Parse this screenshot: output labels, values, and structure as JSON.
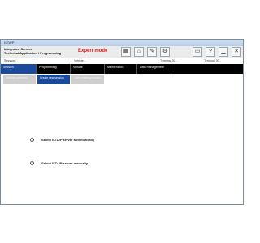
{
  "window": {
    "title": "ISTA/P"
  },
  "header": {
    "app_title_line1": "Integrated Service",
    "app_title_line2": "Technical Application / Programming",
    "mode": "Expert mode"
  },
  "toolbar": {
    "buttons": [
      {
        "name": "grid-icon",
        "glyph": "▦"
      },
      {
        "name": "home-icon",
        "glyph": "⌂"
      },
      {
        "name": "wrench-icon",
        "glyph": "✎"
      },
      {
        "name": "plugin-icon",
        "glyph": "⚙"
      },
      {
        "name": "window-icon",
        "glyph": "▭"
      },
      {
        "name": "help-icon",
        "glyph": "?"
      },
      {
        "name": "minimize-icon",
        "glyph": "▁"
      },
      {
        "name": "close-icon",
        "glyph": "✕"
      }
    ]
  },
  "selectors": {
    "session": "Session -",
    "vehicle": "Vehicle -",
    "terminal_30": "Terminal 30 -",
    "terminal_15": "Terminal 30 -"
  },
  "nav": {
    "tabs": [
      {
        "label": "Session",
        "active": true
      },
      {
        "label": "Programming",
        "active": false
      },
      {
        "label": "Vehicle",
        "active": false
      },
      {
        "label": "Maintenance",
        "active": false
      },
      {
        "label": "Data management",
        "active": false
      }
    ]
  },
  "subnav": {
    "tabs": [
      {
        "label": "Session overview",
        "active": false
      },
      {
        "label": "Create new session",
        "active": true
      },
      {
        "label": "Open existing session",
        "active": false
      }
    ]
  },
  "options": {
    "auto": {
      "label": "Select ISTA/P server automatically",
      "checked": true
    },
    "manual": {
      "label": "Select ISTA/P server manually",
      "checked": false
    }
  }
}
